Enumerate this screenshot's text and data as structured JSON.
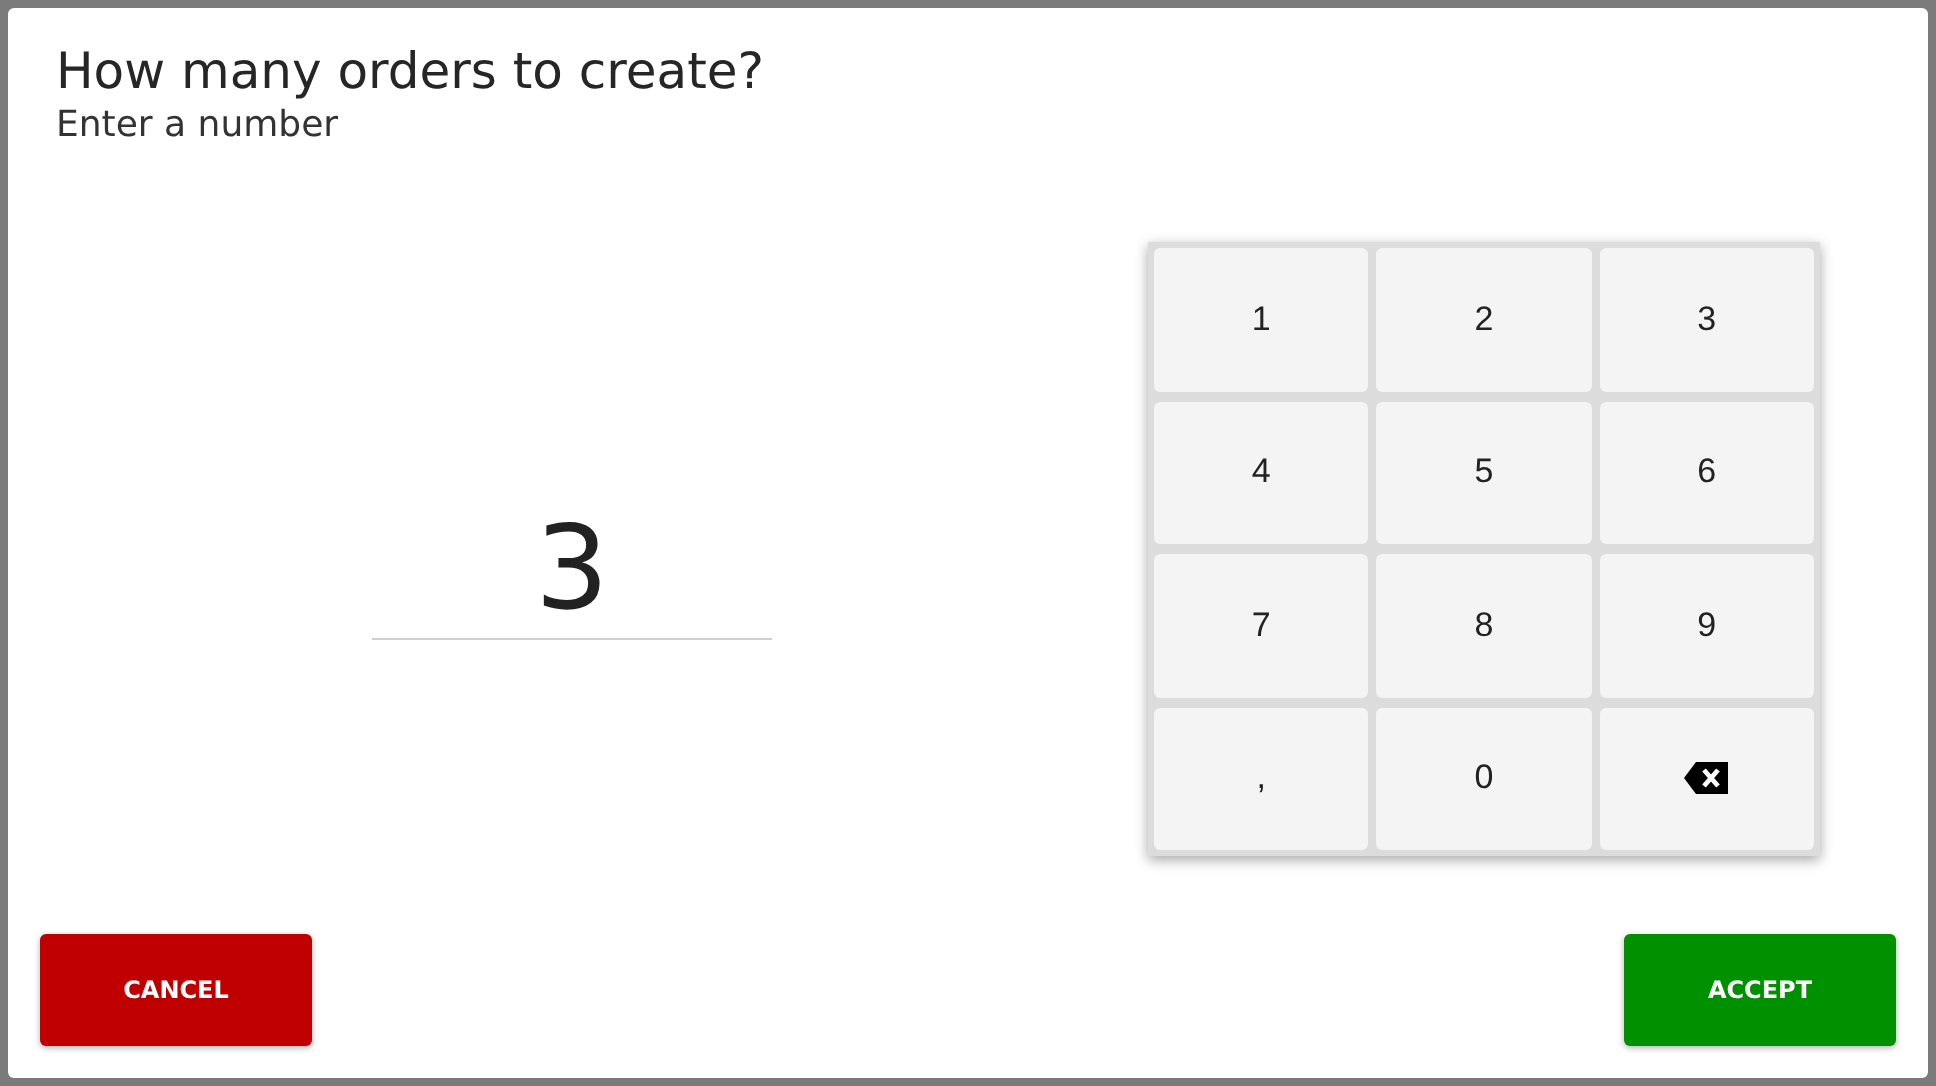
{
  "dialog": {
    "title": "How many orders to create?",
    "subtitle": "Enter a number"
  },
  "field": {
    "value": "3"
  },
  "keypad": {
    "keys": [
      {
        "kind": "key",
        "label": "1"
      },
      {
        "kind": "key",
        "label": "2"
      },
      {
        "kind": "key",
        "label": "3"
      },
      {
        "kind": "key",
        "label": "4"
      },
      {
        "kind": "key",
        "label": "5"
      },
      {
        "kind": "key",
        "label": "6"
      },
      {
        "kind": "key",
        "label": "7"
      },
      {
        "kind": "key",
        "label": "8"
      },
      {
        "kind": "key",
        "label": "9"
      },
      {
        "kind": "key",
        "label": ","
      },
      {
        "kind": "key",
        "label": "0"
      },
      {
        "kind": "backspace"
      }
    ]
  },
  "buttons": [
    {
      "kind": "cancel",
      "label": "CANCEL"
    },
    {
      "kind": "accept",
      "label": "ACCEPT"
    }
  ]
}
